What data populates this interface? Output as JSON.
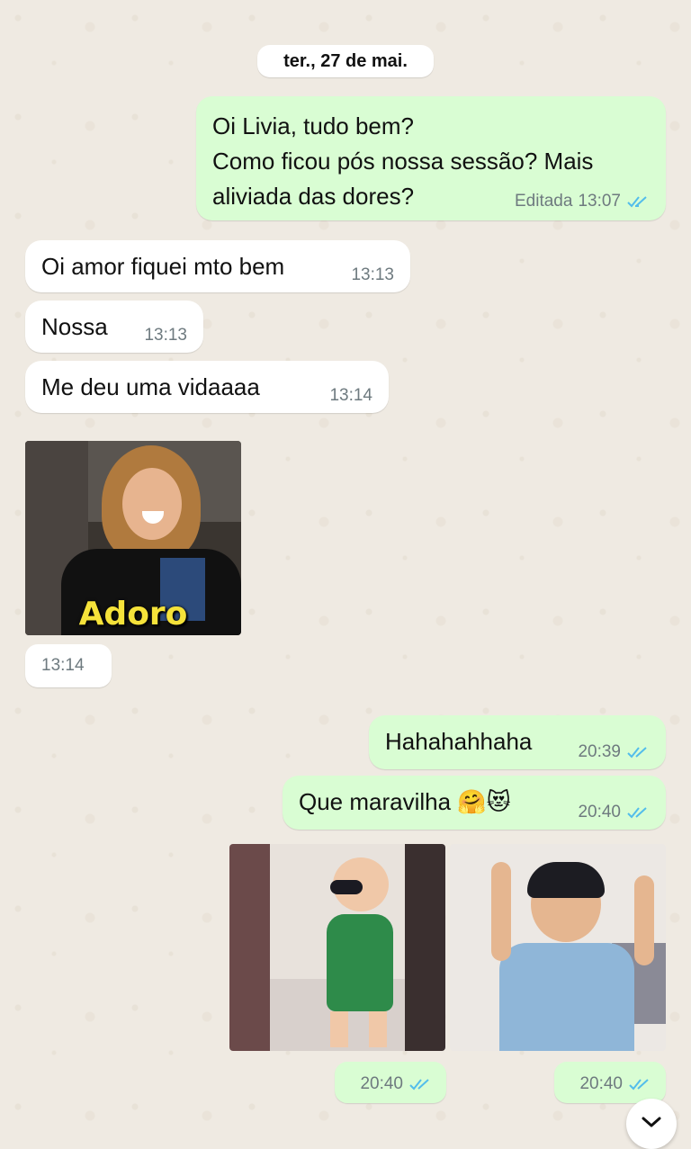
{
  "chat": {
    "date": "ter., 27 de mai.",
    "msg1": {
      "text": "Oi Livia, tudo bem?\nComo ficou pós nossa sessão? Mais\naliviada das dores?",
      "edited": "Editada",
      "time": "13:07"
    },
    "msg2": {
      "text": "Oi amor fiquei mto bem",
      "time": "13:13"
    },
    "msg3": {
      "text": "Nossa",
      "time": "13:13"
    },
    "msg4": {
      "text": "Me deu uma vidaaaa",
      "time": "13:14"
    },
    "gif1": {
      "caption": "Adoro",
      "time": "13:14"
    },
    "msg5": {
      "text": "Hahahahhaha",
      "time": "20:39"
    },
    "msg6": {
      "text": "Que maravilha 🤗😻",
      "time": "20:40"
    },
    "gif2": {
      "time": "20:40"
    },
    "gif3": {
      "time": "20:40"
    }
  },
  "colors": {
    "outgoing": "#d9fdd3",
    "incoming": "#ffffff",
    "read_ticks": "#53bdeb",
    "background": "#efeae2"
  },
  "icons": {
    "read": "double-check-icon",
    "scroll": "chevron-down-icon"
  }
}
